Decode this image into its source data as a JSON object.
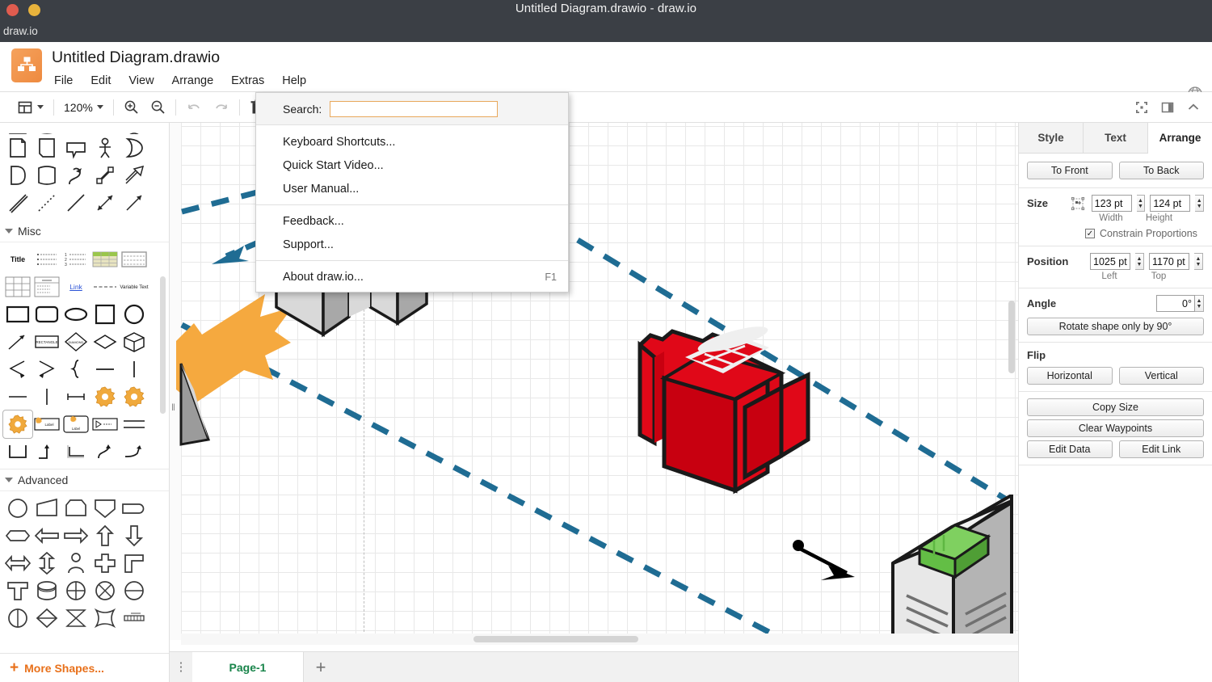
{
  "window": {
    "title": "Untitled Diagram.drawio - draw.io",
    "app_name": "draw.io",
    "traffic_lights": [
      "close-red",
      "minimize-yellow"
    ]
  },
  "header": {
    "document_title": "Untitled Diagram.drawio",
    "menus": [
      "File",
      "Edit",
      "View",
      "Arrange",
      "Extras",
      "Help"
    ],
    "language_icon": "globe-icon"
  },
  "toolbar": {
    "view_layers_icon": "view-layout-icon",
    "zoom_level": "120%",
    "zoom_in_icon": "zoom-in-icon",
    "zoom_out_icon": "zoom-out-icon",
    "undo_icon": "undo-icon",
    "redo_icon": "redo-icon",
    "delete_icon": "trash-icon",
    "right_icons": [
      "fullscreen-icon",
      "format-panel-icon",
      "collapse-icon"
    ]
  },
  "help_menu": {
    "search_label": "Search:",
    "search_value": "",
    "search_placeholder": "",
    "group1": [
      {
        "label": "Keyboard Shortcuts...",
        "accel": ""
      },
      {
        "label": "Quick Start Video...",
        "accel": ""
      },
      {
        "label": "User Manual...",
        "accel": ""
      }
    ],
    "group2": [
      {
        "label": "Feedback...",
        "accel": ""
      },
      {
        "label": "Support...",
        "accel": ""
      }
    ],
    "group3": [
      {
        "label": "About draw.io...",
        "accel": "F1"
      }
    ]
  },
  "shapes_panel": {
    "sections": [
      {
        "title": "Misc",
        "expanded": true
      },
      {
        "title": "Advanced",
        "expanded": true
      }
    ],
    "more_shapes_label": "More Shapes...",
    "more_shapes_plus": "+",
    "misc_labels": [
      "Title",
      "Link",
      "Variable Text"
    ]
  },
  "canvas": {
    "grid_size_px": 24,
    "page_break_visible": true,
    "shapes": [
      {
        "name": "red-3d-building",
        "color": "#E00818",
        "top_face_color": "#EFEFEF"
      },
      {
        "name": "gray-3d-block",
        "color": "#D4D4D4",
        "side_color": "#9B9B9B"
      },
      {
        "name": "orange-arrow-shape",
        "color": "#F5A93F"
      },
      {
        "name": "white-gray-box-with-green-top",
        "color": "#E8E8E8",
        "accent": "#68C34A"
      },
      {
        "name": "blue-dashed-connector",
        "color": "#1F6C93"
      },
      {
        "name": "black-arrow-connector",
        "color": "#000000"
      }
    ]
  },
  "pagebar": {
    "menu_icon": "vertical-dots-icon",
    "tabs": [
      "Page-1"
    ],
    "active_tab": "Page-1",
    "add_label": "+"
  },
  "format_panel": {
    "tabs": [
      "Style",
      "Text",
      "Arrange"
    ],
    "active_tab": "Arrange",
    "order": {
      "to_front": "To Front",
      "to_back": "To Back"
    },
    "size": {
      "label": "Size",
      "autosize_icon": "autosize-icon",
      "width_value": "123 pt",
      "height_value": "124 pt",
      "width_label": "Width",
      "height_label": "Height",
      "constrain_label": "Constrain Proportions",
      "constrain_checked": true
    },
    "position": {
      "label": "Position",
      "left_value": "1025 pt",
      "top_value": "1170 pt",
      "left_label": "Left",
      "top_label": "Top"
    },
    "angle": {
      "label": "Angle",
      "value": "0°",
      "rotate_button": "Rotate shape only by 90°"
    },
    "flip": {
      "label": "Flip",
      "horizontal": "Horizontal",
      "vertical": "Vertical"
    },
    "actions": {
      "copy_size": "Copy Size",
      "clear_waypoints": "Clear Waypoints",
      "edit_data": "Edit Data",
      "edit_link": "Edit Link"
    }
  },
  "colors": {
    "titlebar": "#3b3f45",
    "accent_orange": "#e8701a",
    "tab_green": "#18844a",
    "connector_blue": "#1F6C93",
    "shape_red": "#E00818",
    "shape_orange": "#F5A93F",
    "shape_green": "#68C34A"
  }
}
